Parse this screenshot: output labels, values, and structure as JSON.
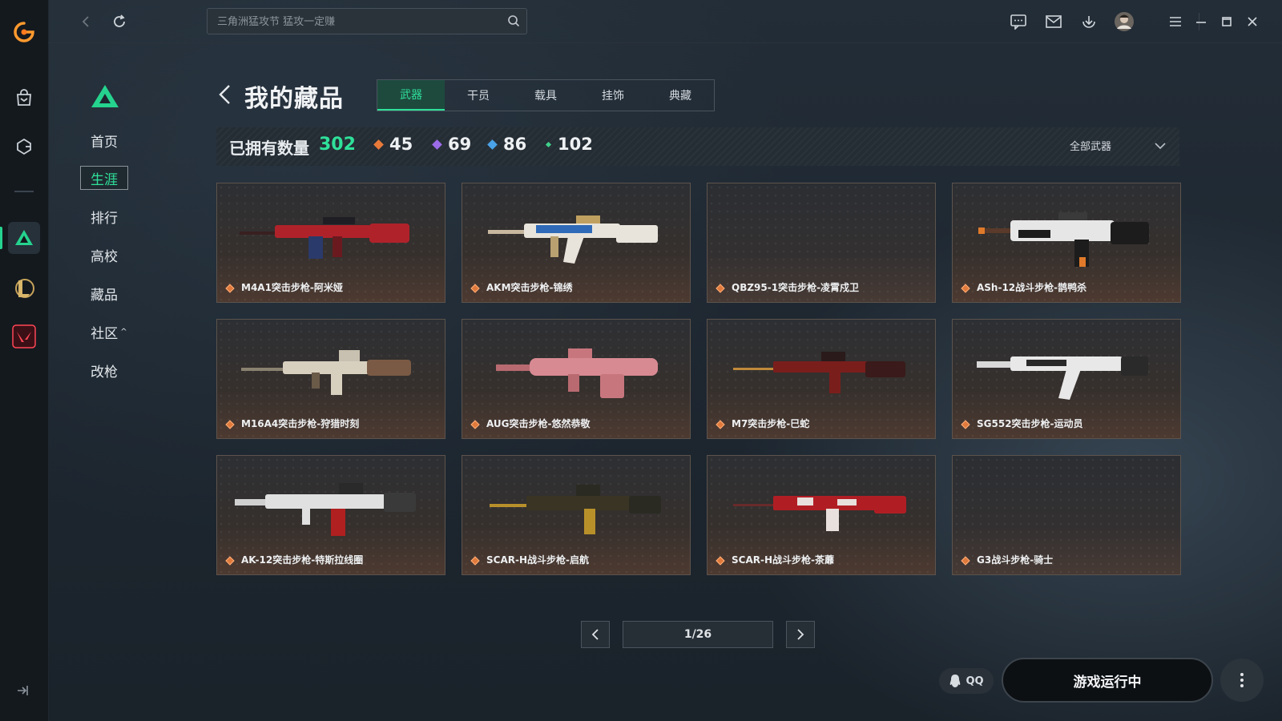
{
  "search": {
    "placeholder": "三角洲猛攻节 猛攻一定赚"
  },
  "rail": {
    "items": [
      {
        "icon": "app-logo-icon"
      },
      {
        "icon": "store-bag-icon"
      },
      {
        "icon": "game-tag-icon"
      },
      {
        "icon": "delta-force-icon"
      },
      {
        "icon": "league-of-legends-icon"
      },
      {
        "icon": "valorant-icon"
      }
    ]
  },
  "topbar": {
    "icons": [
      "chat-icon",
      "mail-icon",
      "download-icon",
      "avatar",
      "menu-icon",
      "minimize-icon",
      "maximize-icon",
      "close-icon"
    ]
  },
  "subnav": {
    "items": [
      {
        "label": "首页"
      },
      {
        "label": "生涯",
        "active": true
      },
      {
        "label": "排行"
      },
      {
        "label": "高校"
      },
      {
        "label": "藏品"
      },
      {
        "label": "社区",
        "caret": "^"
      },
      {
        "label": "改枪"
      }
    ]
  },
  "header": {
    "title": "我的藏品",
    "tabs": [
      {
        "label": "武器",
        "active": true
      },
      {
        "label": "干员"
      },
      {
        "label": "载具"
      },
      {
        "label": "挂饰"
      },
      {
        "label": "典藏"
      }
    ]
  },
  "stats": {
    "owned_label": "已拥有数量",
    "owned_count": "302",
    "tiers": [
      {
        "color": "#e87a3a",
        "value": "45"
      },
      {
        "color": "#9b6be8",
        "value": "69"
      },
      {
        "color": "#4aa3e8",
        "value": "86"
      },
      {
        "color": "#3fd08a",
        "value": "102"
      }
    ],
    "filter": "全部武器"
  },
  "items": [
    {
      "name": "M4A1突击步枪-阿米娅",
      "colors": [
        "#b0222a",
        "#2a3a6a"
      ]
    },
    {
      "name": "AKM突击步枪-锦绣",
      "colors": [
        "#e8e4dc",
        "#2f6ab8"
      ]
    },
    {
      "name": "QBZ95-1突击步枪-凌霄戍卫",
      "colors": []
    },
    {
      "name": "ASh-12战斗步枪-鹊鸭杀",
      "colors": [
        "#e6e6e6",
        "#1c1c1c"
      ]
    },
    {
      "name": "M16A4突击步枪-狩猎时刻",
      "colors": [
        "#d8d0bf",
        "#7a5a44"
      ]
    },
    {
      "name": "AUG突击步枪-悠然恭敬",
      "colors": [
        "#d88a92",
        "#b86a70"
      ]
    },
    {
      "name": "M7突击步枪-巳蛇",
      "colors": [
        "#7a1e1c",
        "#c08a3a"
      ]
    },
    {
      "name": "SG552突击步枪-运动员",
      "colors": [
        "#e8e8e8",
        "#2a2a2a"
      ]
    },
    {
      "name": "AK-12突击步枪-特斯拉线圈",
      "colors": [
        "#e0e0e0",
        "#b02020"
      ]
    },
    {
      "name": "SCAR-H战斗步枪-启航",
      "colors": [
        "#3a3424",
        "#b8902a"
      ]
    },
    {
      "name": "SCAR-H战斗步枪-茶蘼",
      "colors": [
        "#b01e24",
        "#e8e0dc"
      ]
    },
    {
      "name": "G3战斗步枪-骑士",
      "colors": []
    }
  ],
  "pager": {
    "text": "1/26"
  },
  "footer": {
    "qq_label": "QQ",
    "play_label": "游戏运行中"
  }
}
